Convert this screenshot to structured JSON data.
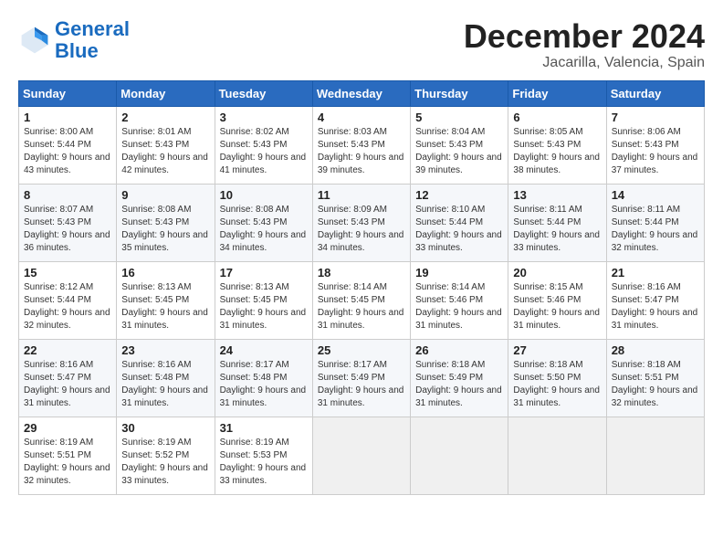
{
  "header": {
    "logo_line1": "General",
    "logo_line2": "Blue",
    "month": "December 2024",
    "location": "Jacarilla, Valencia, Spain"
  },
  "days_of_week": [
    "Sunday",
    "Monday",
    "Tuesday",
    "Wednesday",
    "Thursday",
    "Friday",
    "Saturday"
  ],
  "weeks": [
    [
      {
        "day": 1,
        "sunrise": "8:00 AM",
        "sunset": "5:44 PM",
        "daylight": "9 hours and 43 minutes."
      },
      {
        "day": 2,
        "sunrise": "8:01 AM",
        "sunset": "5:43 PM",
        "daylight": "9 hours and 42 minutes."
      },
      {
        "day": 3,
        "sunrise": "8:02 AM",
        "sunset": "5:43 PM",
        "daylight": "9 hours and 41 minutes."
      },
      {
        "day": 4,
        "sunrise": "8:03 AM",
        "sunset": "5:43 PM",
        "daylight": "9 hours and 39 minutes."
      },
      {
        "day": 5,
        "sunrise": "8:04 AM",
        "sunset": "5:43 PM",
        "daylight": "9 hours and 39 minutes."
      },
      {
        "day": 6,
        "sunrise": "8:05 AM",
        "sunset": "5:43 PM",
        "daylight": "9 hours and 38 minutes."
      },
      {
        "day": 7,
        "sunrise": "8:06 AM",
        "sunset": "5:43 PM",
        "daylight": "9 hours and 37 minutes."
      }
    ],
    [
      {
        "day": 8,
        "sunrise": "8:07 AM",
        "sunset": "5:43 PM",
        "daylight": "9 hours and 36 minutes."
      },
      {
        "day": 9,
        "sunrise": "8:08 AM",
        "sunset": "5:43 PM",
        "daylight": "9 hours and 35 minutes."
      },
      {
        "day": 10,
        "sunrise": "8:08 AM",
        "sunset": "5:43 PM",
        "daylight": "9 hours and 34 minutes."
      },
      {
        "day": 11,
        "sunrise": "8:09 AM",
        "sunset": "5:43 PM",
        "daylight": "9 hours and 34 minutes."
      },
      {
        "day": 12,
        "sunrise": "8:10 AM",
        "sunset": "5:44 PM",
        "daylight": "9 hours and 33 minutes."
      },
      {
        "day": 13,
        "sunrise": "8:11 AM",
        "sunset": "5:44 PM",
        "daylight": "9 hours and 33 minutes."
      },
      {
        "day": 14,
        "sunrise": "8:11 AM",
        "sunset": "5:44 PM",
        "daylight": "9 hours and 32 minutes."
      }
    ],
    [
      {
        "day": 15,
        "sunrise": "8:12 AM",
        "sunset": "5:44 PM",
        "daylight": "9 hours and 32 minutes."
      },
      {
        "day": 16,
        "sunrise": "8:13 AM",
        "sunset": "5:45 PM",
        "daylight": "9 hours and 31 minutes."
      },
      {
        "day": 17,
        "sunrise": "8:13 AM",
        "sunset": "5:45 PM",
        "daylight": "9 hours and 31 minutes."
      },
      {
        "day": 18,
        "sunrise": "8:14 AM",
        "sunset": "5:45 PM",
        "daylight": "9 hours and 31 minutes."
      },
      {
        "day": 19,
        "sunrise": "8:14 AM",
        "sunset": "5:46 PM",
        "daylight": "9 hours and 31 minutes."
      },
      {
        "day": 20,
        "sunrise": "8:15 AM",
        "sunset": "5:46 PM",
        "daylight": "9 hours and 31 minutes."
      },
      {
        "day": 21,
        "sunrise": "8:16 AM",
        "sunset": "5:47 PM",
        "daylight": "9 hours and 31 minutes."
      }
    ],
    [
      {
        "day": 22,
        "sunrise": "8:16 AM",
        "sunset": "5:47 PM",
        "daylight": "9 hours and 31 minutes."
      },
      {
        "day": 23,
        "sunrise": "8:16 AM",
        "sunset": "5:48 PM",
        "daylight": "9 hours and 31 minutes."
      },
      {
        "day": 24,
        "sunrise": "8:17 AM",
        "sunset": "5:48 PM",
        "daylight": "9 hours and 31 minutes."
      },
      {
        "day": 25,
        "sunrise": "8:17 AM",
        "sunset": "5:49 PM",
        "daylight": "9 hours and 31 minutes."
      },
      {
        "day": 26,
        "sunrise": "8:18 AM",
        "sunset": "5:49 PM",
        "daylight": "9 hours and 31 minutes."
      },
      {
        "day": 27,
        "sunrise": "8:18 AM",
        "sunset": "5:50 PM",
        "daylight": "9 hours and 31 minutes."
      },
      {
        "day": 28,
        "sunrise": "8:18 AM",
        "sunset": "5:51 PM",
        "daylight": "9 hours and 32 minutes."
      }
    ],
    [
      {
        "day": 29,
        "sunrise": "8:19 AM",
        "sunset": "5:51 PM",
        "daylight": "9 hours and 32 minutes."
      },
      {
        "day": 30,
        "sunrise": "8:19 AM",
        "sunset": "5:52 PM",
        "daylight": "9 hours and 33 minutes."
      },
      {
        "day": 31,
        "sunrise": "8:19 AM",
        "sunset": "5:53 PM",
        "daylight": "9 hours and 33 minutes."
      },
      null,
      null,
      null,
      null
    ]
  ]
}
